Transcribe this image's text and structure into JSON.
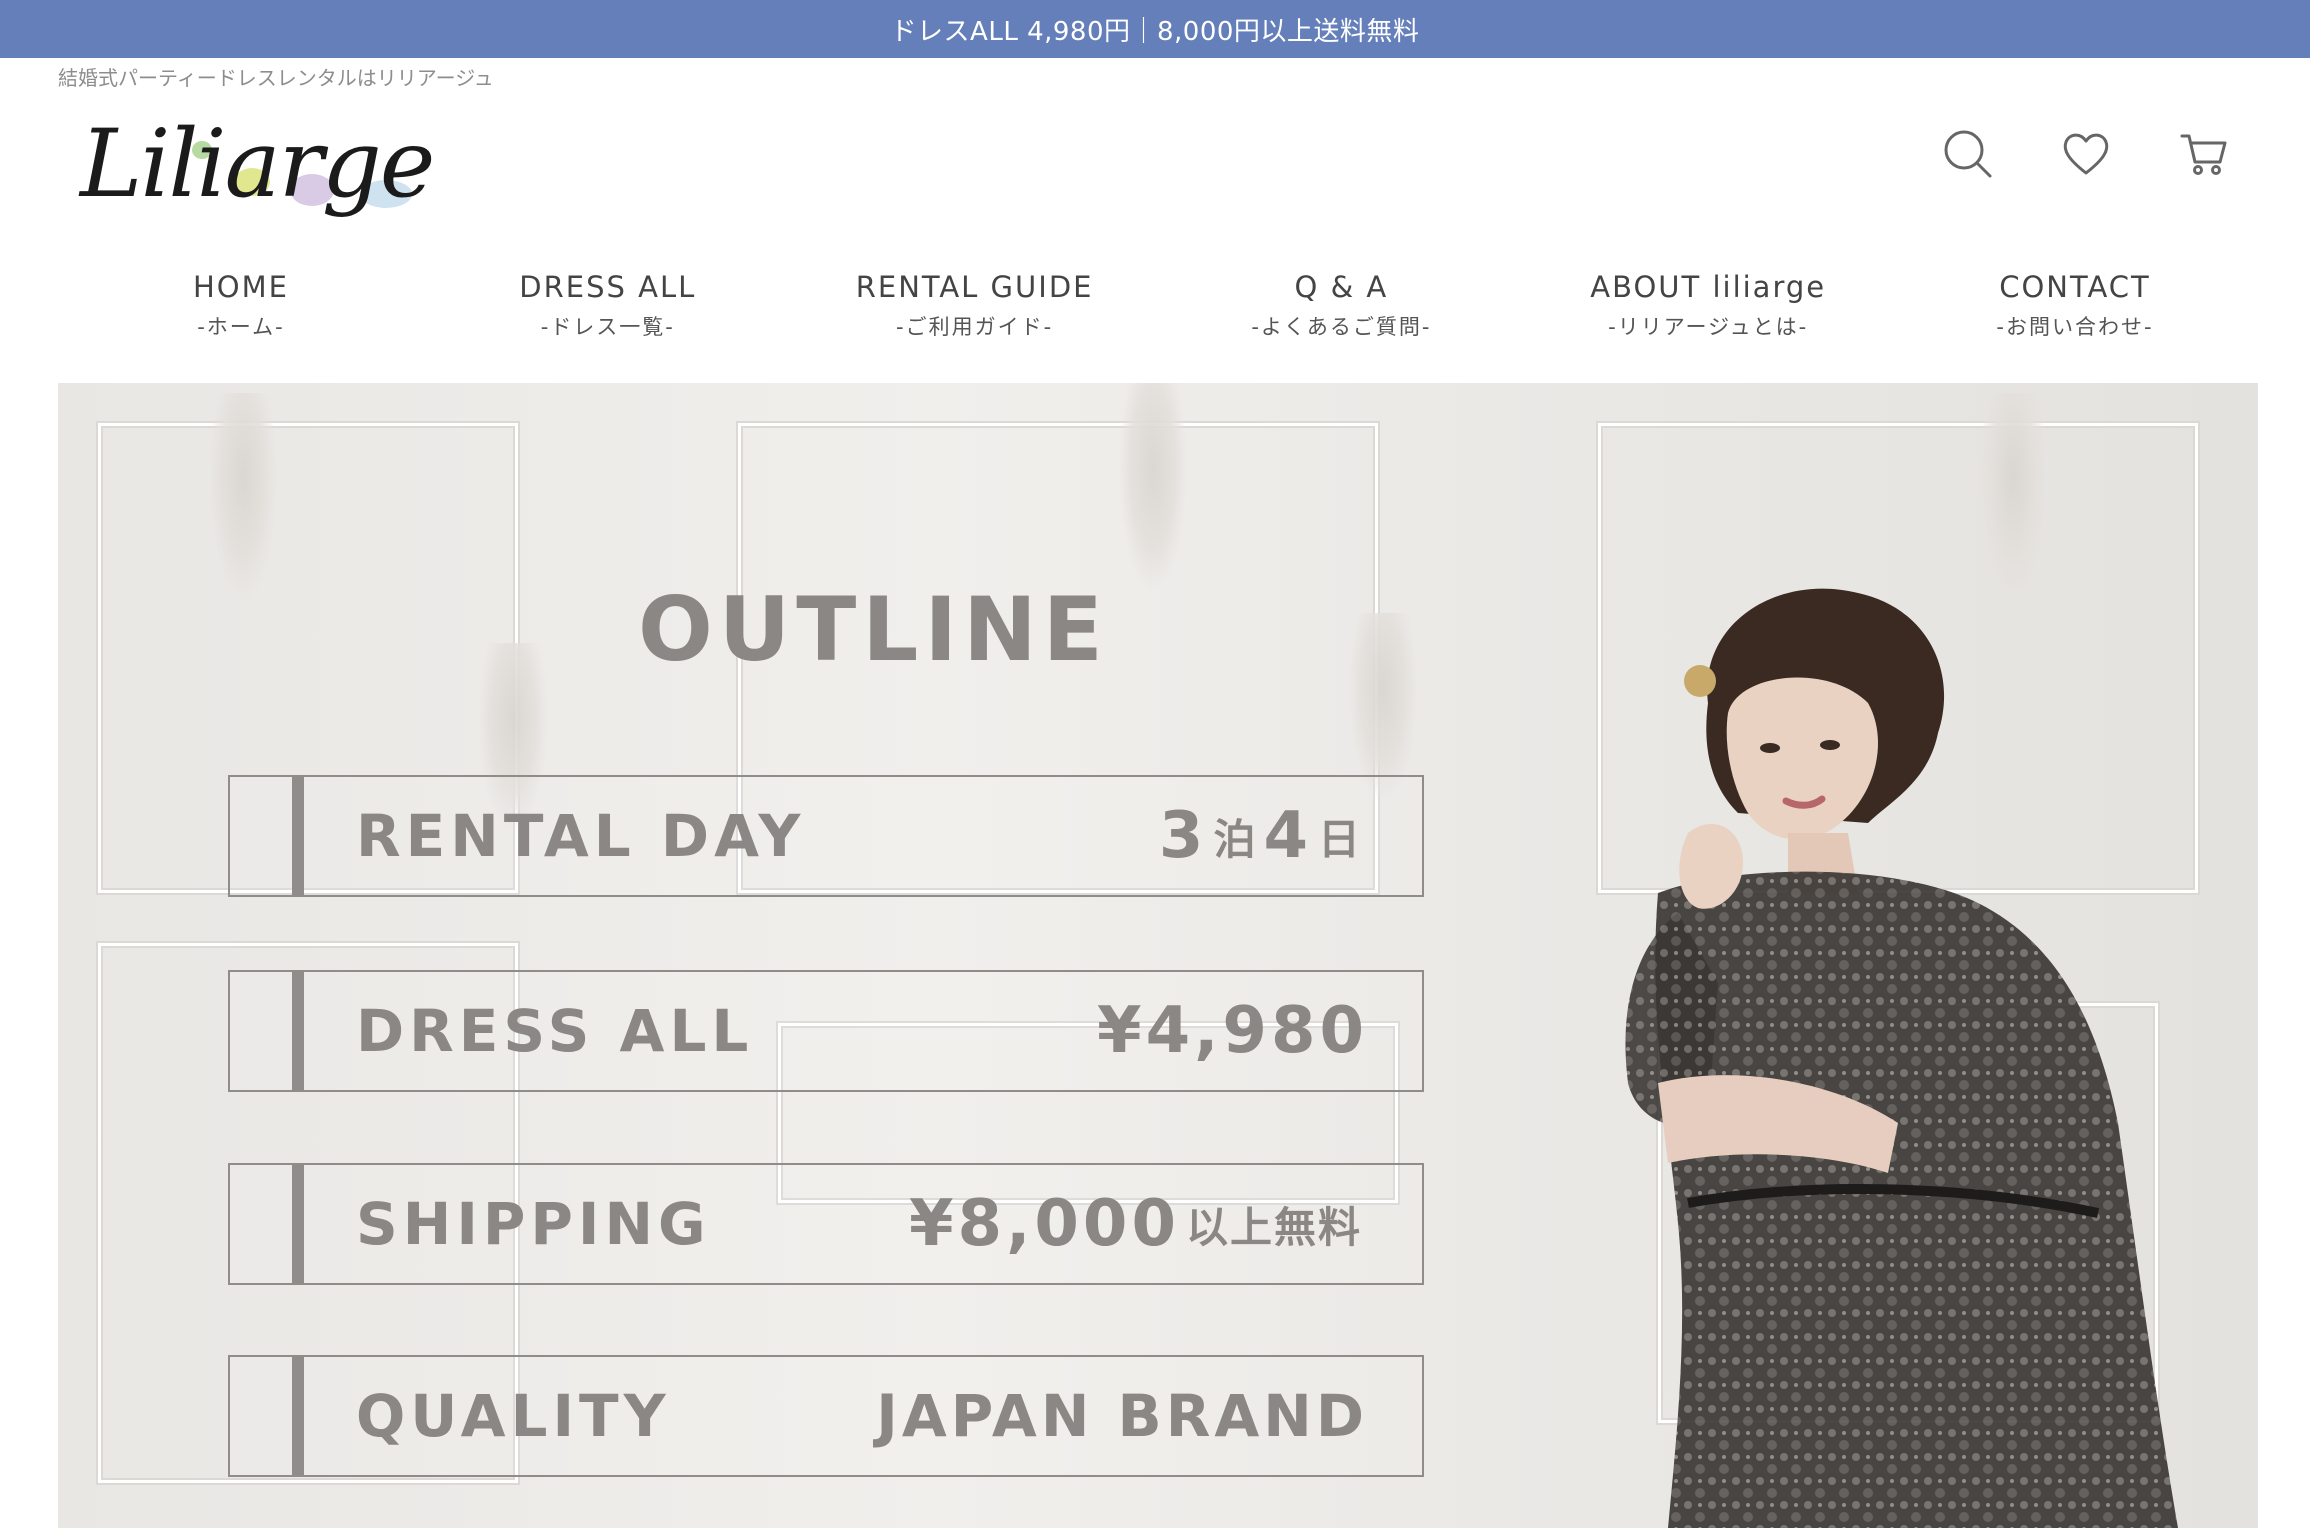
{
  "announcement": "ドレスALL 4,980円｜8,000円以上送料無料",
  "tagline": "結婚式パーティードレスレンタルはリリアージュ",
  "logo": {
    "text": "Liliarge"
  },
  "header_icons": [
    "search-icon",
    "heart-icon",
    "cart-icon"
  ],
  "nav": [
    {
      "main": "HOME",
      "sub": "-ホーム-"
    },
    {
      "main": "DRESS ALL",
      "sub": "-ドレス一覧-"
    },
    {
      "main": "RENTAL GUIDE",
      "sub": "-ご利用ガイド-"
    },
    {
      "main": "Q & A",
      "sub": "-よくあるご質問-"
    },
    {
      "main": "ABOUT liliarge",
      "sub": "-リリアージュとは-"
    },
    {
      "main": "CONTACT",
      "sub": "-お問い合わせ-"
    }
  ],
  "hero": {
    "title": "OUTLINE",
    "rows": [
      {
        "label": "RENTAL DAY",
        "value_parts": [
          "3",
          "泊",
          "4",
          "日"
        ]
      },
      {
        "label": "DRESS ALL",
        "value_parts": [
          "¥4,980"
        ]
      },
      {
        "label": "SHIPPING",
        "value_parts": [
          "¥8,000",
          "以上無料"
        ]
      },
      {
        "label": "QUALITY",
        "value_parts": [
          "JAPAN BRAND"
        ]
      }
    ]
  },
  "colors": {
    "announcement_bg": "#647fb9",
    "hero_text": "#8b8784",
    "nav_text": "#444444"
  }
}
